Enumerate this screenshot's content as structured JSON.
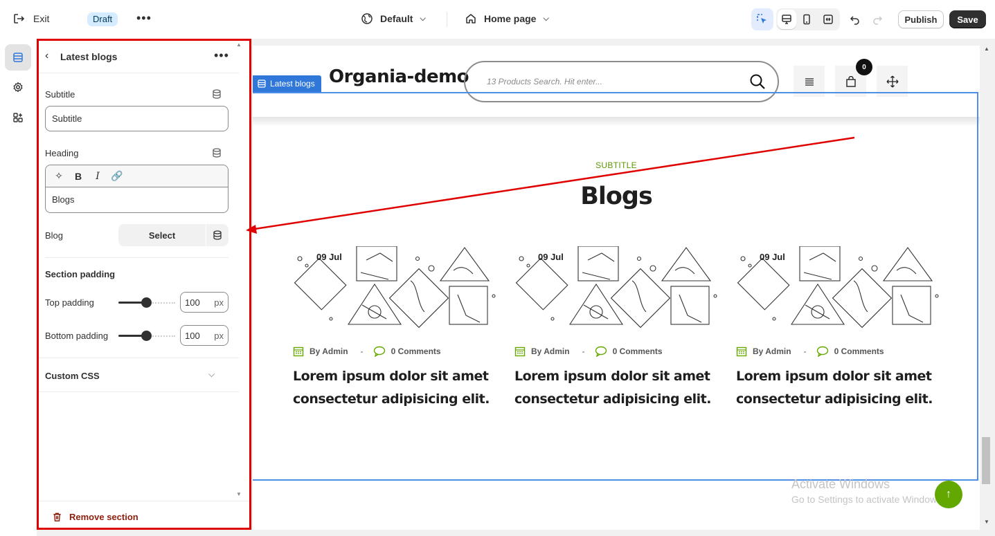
{
  "topbar": {
    "exit_label": "Exit",
    "status_badge": "Draft",
    "theme_select": "Default",
    "page_select": "Home page",
    "publish_label": "Publish",
    "save_label": "Save"
  },
  "panel": {
    "title": "Latest blogs",
    "subtitle_label": "Subtitle",
    "subtitle_value": "Subtitle",
    "heading_label": "Heading",
    "heading_value": "Blogs",
    "blog_label": "Blog",
    "blog_select_label": "Select",
    "section_padding_title": "Section padding",
    "top_padding_label": "Top padding",
    "top_padding_value": "100",
    "bottom_padding_label": "Bottom padding",
    "bottom_padding_value": "100",
    "unit": "px",
    "custom_css_label": "Custom CSS",
    "remove_label": "Remove section"
  },
  "preview": {
    "store_name": "Organia-demo",
    "search_placeholder": "13 Products Search. Hit enter...",
    "cart_count": "0",
    "selected_section_tag": "Latest blogs",
    "section_subtitle": "SUBTITLE",
    "section_heading": "Blogs",
    "posts": [
      {
        "date": "09 Jul",
        "author": "By Admin",
        "sep": "-",
        "comments": "0 Comments",
        "title": "Lorem ipsum dolor sit amet consectetur adipisicing elit."
      },
      {
        "date": "09 Jul",
        "author": "By Admin",
        "sep": "-",
        "comments": "0 Comments",
        "title": "Lorem ipsum dolor sit amet consectetur adipisicing elit."
      },
      {
        "date": "09 Jul",
        "author": "By Admin",
        "sep": "-",
        "comments": "0 Comments",
        "title": "Lorem ipsum dolor sit amet consectetur adipisicing elit."
      }
    ]
  },
  "watermark": {
    "line1": "Activate Windows",
    "line2": "Go to Settings to activate Windows."
  },
  "colors": {
    "accent_green": "#63a800",
    "selection_blue": "#2f77d9",
    "annotation_red": "#e00000",
    "remove_red": "#8e1f0b"
  },
  "icons": [
    "exit-icon",
    "more-icon",
    "globe-icon",
    "home-icon",
    "chevron-down-icon",
    "inspect-icon",
    "desktop-icon",
    "mobile-icon",
    "fullwidth-icon",
    "undo-icon",
    "redo-icon",
    "sections-icon",
    "gear-icon",
    "apps-icon",
    "back-icon",
    "database-icon",
    "sparkle-icon",
    "bold-icon",
    "italic-icon",
    "link-icon",
    "trash-icon",
    "search-icon",
    "menu-icon",
    "bag-icon",
    "move-icon",
    "calendar-icon",
    "comment-icon",
    "arrow-up-icon"
  ]
}
